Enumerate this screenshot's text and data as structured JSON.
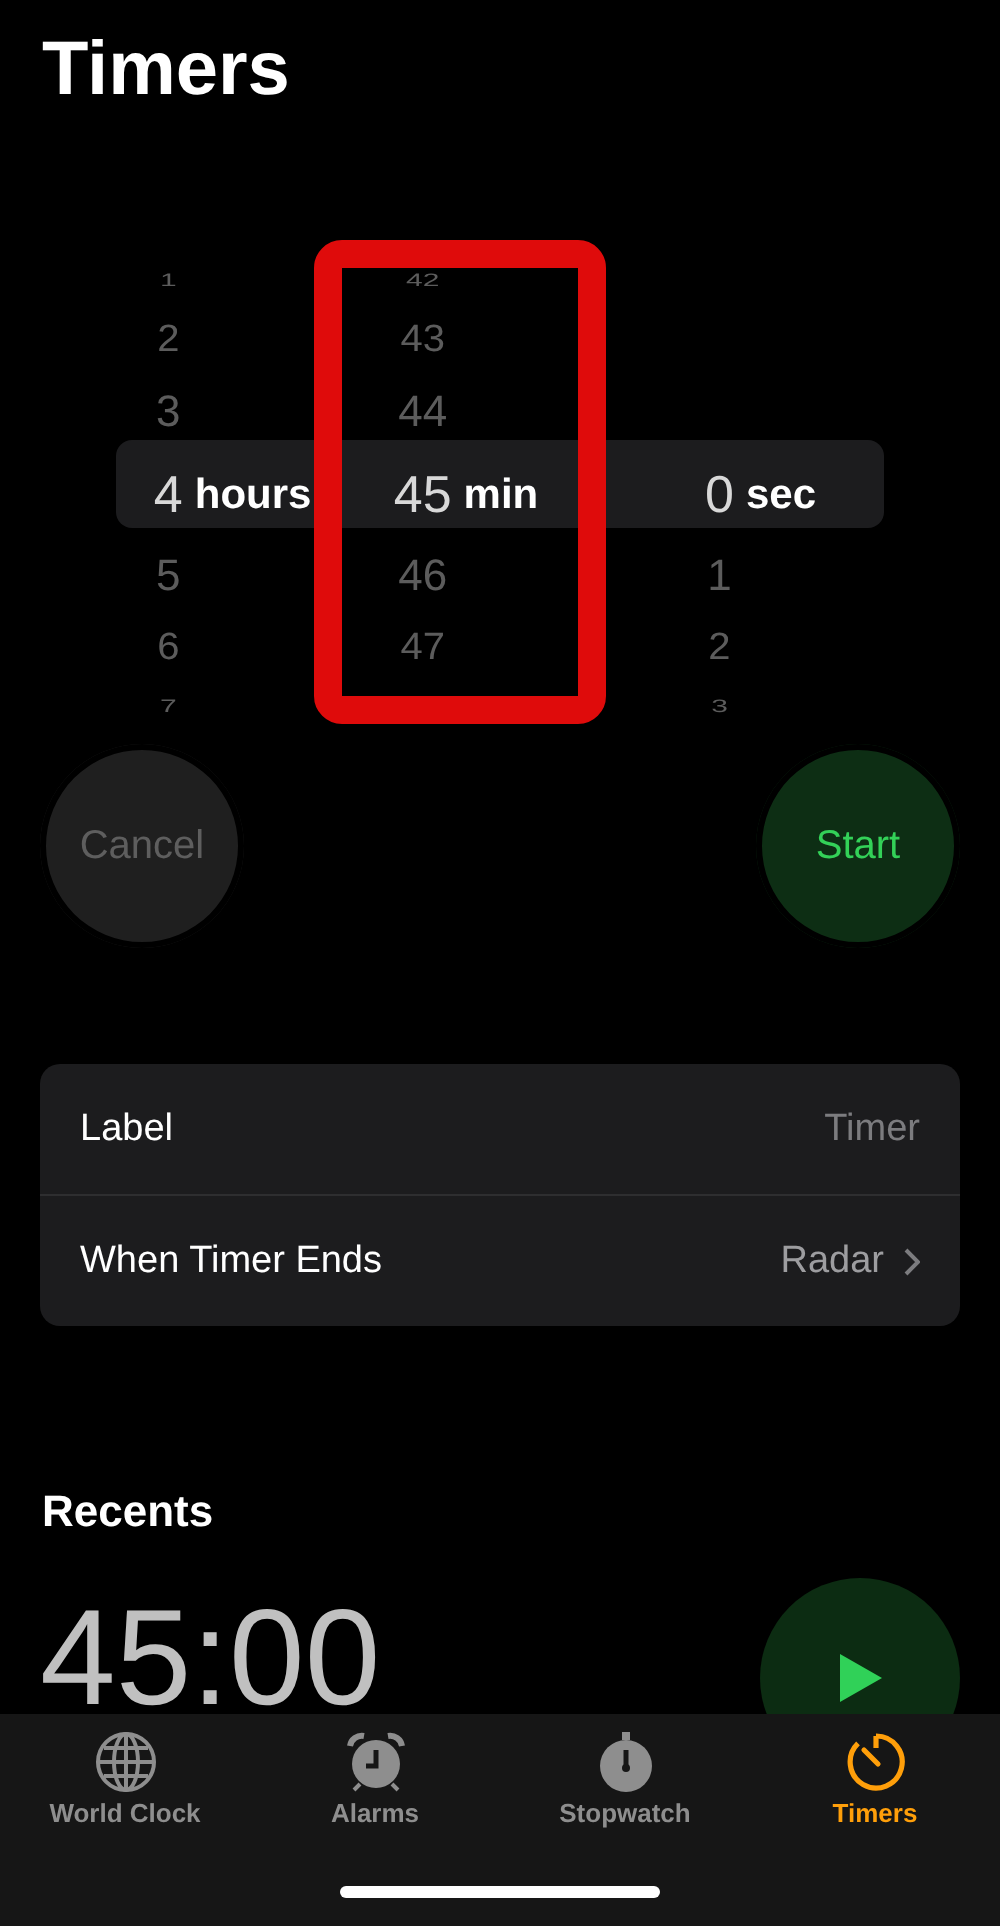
{
  "title": "Timers",
  "picker": {
    "columns": [
      {
        "unit": "hours",
        "highlighted": false,
        "items": [
          {
            "value": "1",
            "selected": false
          },
          {
            "value": "2",
            "selected": false
          },
          {
            "value": "3",
            "selected": false
          },
          {
            "value": "4",
            "selected": true
          },
          {
            "value": "5",
            "selected": false
          },
          {
            "value": "6",
            "selected": false
          },
          {
            "value": "7",
            "selected": false
          }
        ]
      },
      {
        "unit": "min",
        "highlighted": true,
        "items": [
          {
            "value": "42",
            "selected": false
          },
          {
            "value": "43",
            "selected": false
          },
          {
            "value": "44",
            "selected": false
          },
          {
            "value": "45",
            "selected": true
          },
          {
            "value": "46",
            "selected": false
          },
          {
            "value": "47",
            "selected": false
          }
        ]
      },
      {
        "unit": "sec",
        "highlighted": false,
        "items": [
          {
            "value": "0",
            "selected": true
          },
          {
            "value": "1",
            "selected": false
          },
          {
            "value": "2",
            "selected": false
          },
          {
            "value": "3",
            "selected": false
          }
        ]
      }
    ]
  },
  "buttons": [
    {
      "label": "Cancel",
      "kind": "cancel",
      "disabled": true
    },
    {
      "label": "Start",
      "kind": "start",
      "disabled": false
    }
  ],
  "settings": [
    {
      "label": "Label",
      "value": "Timer",
      "kind": "field"
    },
    {
      "label": "When Timer Ends",
      "value": "Radar",
      "kind": "link"
    }
  ],
  "recents": {
    "heading": "Recents",
    "items": [
      {
        "time": "45:00"
      }
    ]
  },
  "tabs": [
    {
      "label": "World Clock",
      "selected": false
    },
    {
      "label": "Alarms",
      "selected": false
    },
    {
      "label": "Stopwatch",
      "selected": false
    },
    {
      "label": "Timers",
      "selected": true
    }
  ]
}
